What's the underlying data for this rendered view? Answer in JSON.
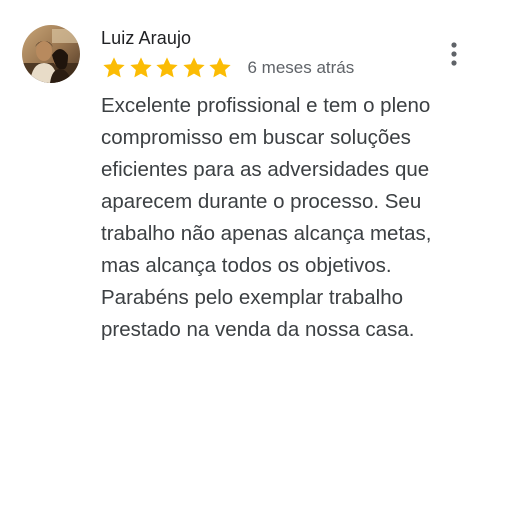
{
  "review": {
    "reviewer_name": "Luiz Araujo",
    "avatar": "avatar-photo",
    "rating": 5,
    "rating_max": 5,
    "date": "6 meses atrás",
    "text": "Excelente profissional e tem o pleno\ncompromisso em buscar soluções\neficientes para as adversidades que\naparecem durante o processo. Seu\ntrabalho não apenas alcança metas,\nmas alcança todos os objetivos.\nParabéns pelo exemplar trabalho\nprestado na venda da nossa casa.",
    "more_icon": "more-vert-icon",
    "star_icon": "star-icon"
  },
  "colors": {
    "star": "#FBBC04",
    "name": "#202124",
    "date": "#5f6368",
    "text": "#3c4043",
    "menu_dots": "#5f6368"
  }
}
